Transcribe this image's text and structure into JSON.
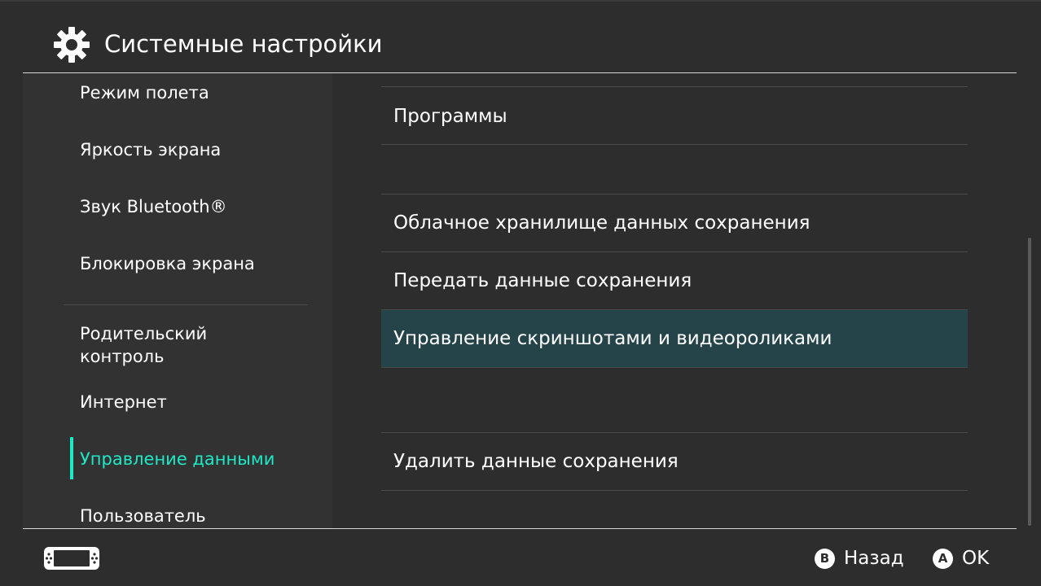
{
  "header": {
    "title": "Системные настройки",
    "icon": "gear-icon"
  },
  "sidebar": {
    "items": [
      {
        "label": "Режим полета"
      },
      {
        "label": "Яркость экрана"
      },
      {
        "label": "Звук Bluetooth®"
      },
      {
        "label": "Блокировка экрана"
      },
      {
        "label_line1": "Родительский",
        "label_line2": "контроль"
      },
      {
        "label": "Интернет"
      },
      {
        "label": "Управление данными",
        "active": true
      },
      {
        "label": "Пользователь"
      }
    ]
  },
  "main": {
    "rows": [
      {
        "label": "Программы"
      },
      {
        "label": "Облачное хранилище данных сохранения"
      },
      {
        "label": "Передать данные сохранения"
      },
      {
        "label": "Управление скриншотами и видеороликами",
        "selected": true
      },
      {
        "label": "Удалить данные сохранения"
      }
    ]
  },
  "footer": {
    "back_button": "B",
    "back_label": "Назад",
    "ok_button": "A",
    "ok_label": "OK",
    "console_icon": "console-icon"
  },
  "colors": {
    "background": "#2d2d2d",
    "sidebar": "#323232",
    "accent": "#1de9c6",
    "selected_row": "#25444a"
  }
}
